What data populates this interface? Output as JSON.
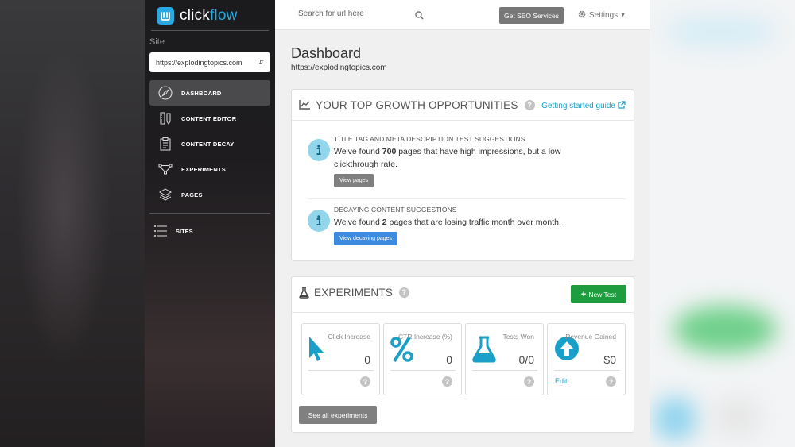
{
  "brand": {
    "name_part1": "click",
    "name_part2": "flow",
    "accent": "#29a9e0"
  },
  "sidebar": {
    "site_label": "Site",
    "site_value": "https://explodingtopics.com",
    "items": [
      {
        "label": "DASHBOARD",
        "icon": "compass-icon",
        "active": true
      },
      {
        "label": "CONTENT EDITOR",
        "icon": "pencil-ruler-icon"
      },
      {
        "label": "CONTENT DECAY",
        "icon": "clipboard-icon"
      },
      {
        "label": "EXPERIMENTS",
        "icon": "vector-nodes-icon"
      },
      {
        "label": "PAGES",
        "icon": "layers-icon"
      }
    ],
    "sites_label": "SITES"
  },
  "topbar": {
    "search_placeholder": "Search for url here",
    "seo_button": "Get SEO Services",
    "settings_label": "Settings"
  },
  "page": {
    "title": "Dashboard",
    "subtitle": "https://explodingtopics.com"
  },
  "growth": {
    "title": "YOUR TOP GROWTH OPPORTUNITIES",
    "guide_link": "Getting started guide",
    "suggestions": [
      {
        "title": "TITLE TAG AND META DESCRIPTION TEST SUGGESTIONS",
        "text_before": "We've found ",
        "count": "700",
        "text_after": " pages that have high impressions, but a low clickthrough rate.",
        "button": "View pages"
      },
      {
        "title": "DECAYING CONTENT SUGGESTIONS",
        "text_before": "We've found ",
        "count": "2",
        "text_after": " pages that are losing traffic month over month.",
        "button": "View decaying pages"
      }
    ]
  },
  "experiments": {
    "title": "EXPERIMENTS",
    "new_test": "New Test",
    "stats": [
      {
        "label": "Click Increase",
        "value": "0",
        "icon": "cursor-icon"
      },
      {
        "label": "CTR Increase (%)",
        "value": "0",
        "icon": "percent-icon"
      },
      {
        "label": "Tests Won",
        "value": "0/0",
        "icon": "flask-icon"
      },
      {
        "label": "Revenue Gained",
        "value": "$0",
        "icon": "arrow-up-circle-icon",
        "edit": "Edit"
      }
    ],
    "see_all": "See all experiments"
  }
}
